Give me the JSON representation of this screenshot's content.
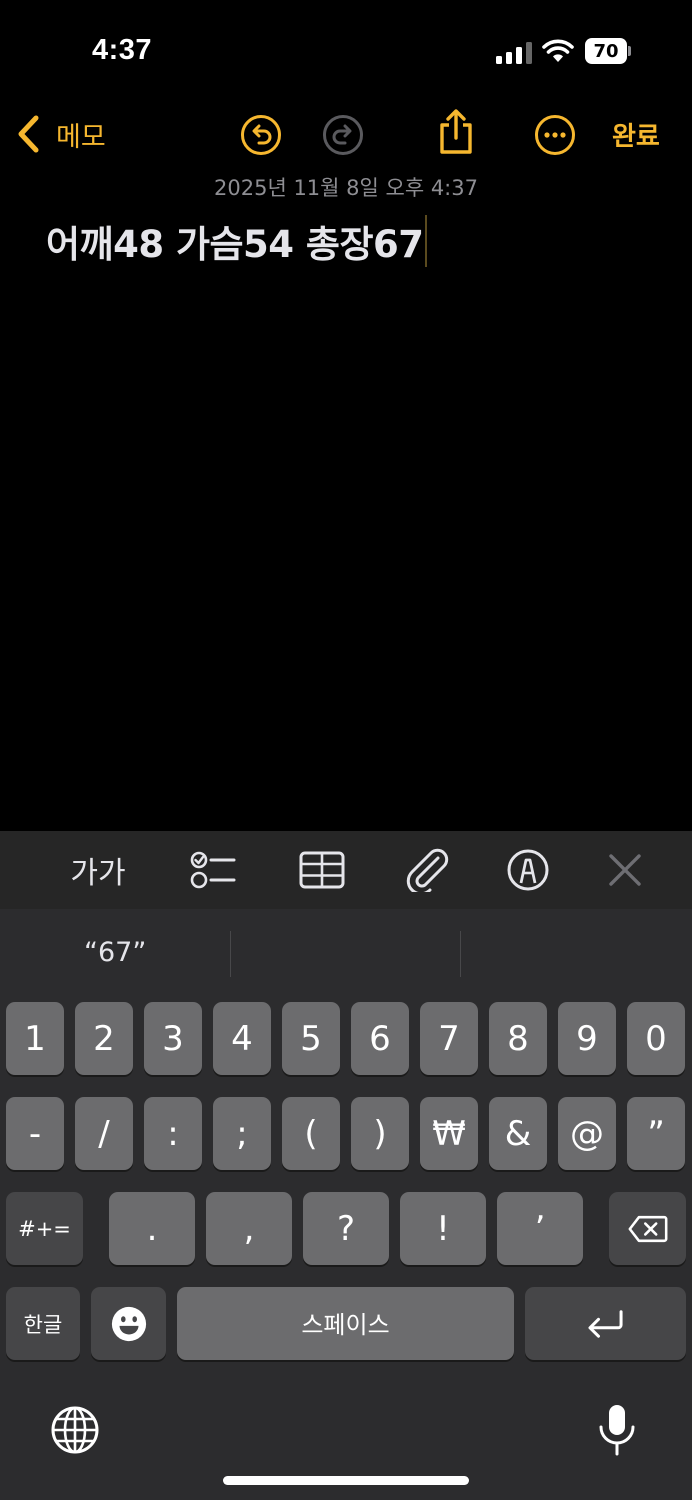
{
  "status_bar": {
    "time": "4:37",
    "battery_level": "70",
    "signal_icon": "cellular-signal-icon",
    "wifi_icon": "wifi-icon"
  },
  "nav": {
    "back_label": "메모",
    "done_label": "완료",
    "icons": [
      "chevron-left-icon",
      "undo-icon",
      "redo-icon",
      "share-icon",
      "more-icon"
    ]
  },
  "note": {
    "date": "2025년 11월 8일 오후 4:37",
    "body": "어깨48 가슴54 총장67"
  },
  "format_toolbar": {
    "text_style_label": "가가",
    "icons": [
      "checklist-icon",
      "table-icon",
      "paperclip-icon",
      "markup-pen-icon",
      "close-icon"
    ]
  },
  "keyboard": {
    "prediction": "“67”",
    "row1": [
      "1",
      "2",
      "3",
      "4",
      "5",
      "6",
      "7",
      "8",
      "9",
      "0"
    ],
    "row2": [
      "-",
      "/",
      ":",
      ";",
      "(",
      ")",
      "₩",
      "&",
      "@",
      "”"
    ],
    "row3_shift": "#+=",
    "row3": [
      ".",
      ",",
      "?",
      "!",
      "’"
    ],
    "lang_key": "한글",
    "space_label": "스페이스",
    "icons": [
      "emoji-icon",
      "backspace-icon",
      "return-icon",
      "globe-icon",
      "microphone-icon"
    ]
  },
  "colors": {
    "accent": "#f6b72f",
    "background": "#000000",
    "keyboard_bg": "#2c2c2e",
    "key_bg": "#6c6c6e",
    "key_dark_bg": "#464648"
  }
}
